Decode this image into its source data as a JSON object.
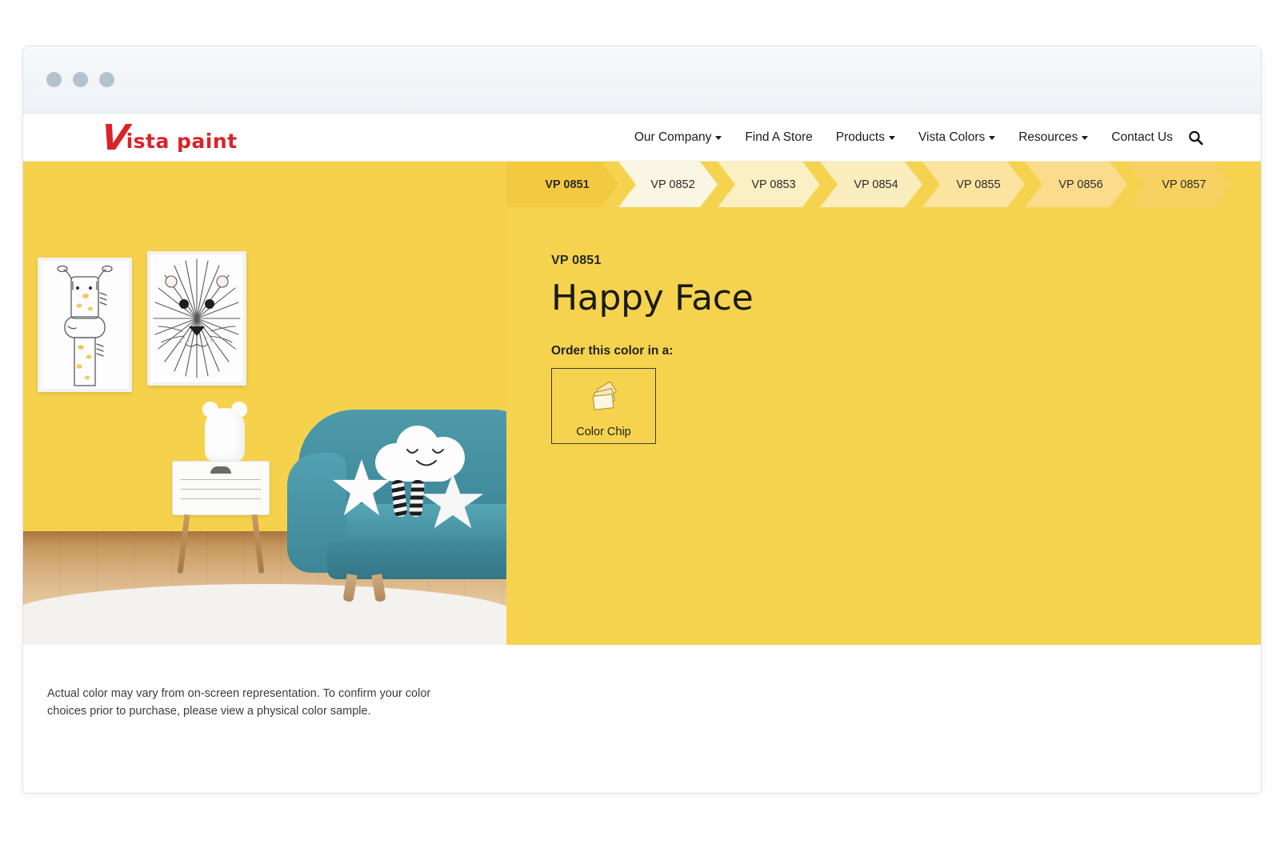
{
  "window": {
    "dots": [
      "close-dot",
      "minimize-dot",
      "maximize-dot"
    ]
  },
  "header": {
    "logo": {
      "initial": "V",
      "rest": "ista paint",
      "full": "Vista Paint",
      "color": "#d8232a"
    },
    "nav": [
      {
        "label": "Our Company",
        "has_caret": true
      },
      {
        "label": "Find A Store",
        "has_caret": false
      },
      {
        "label": "Products",
        "has_caret": true
      },
      {
        "label": "Vista Colors",
        "has_caret": true
      },
      {
        "label": "Resources",
        "has_caret": true
      },
      {
        "label": "Contact Us",
        "has_caret": false
      }
    ],
    "search_icon": "search-icon"
  },
  "chip_tabs": [
    {
      "label": "VP 0851",
      "active": true,
      "fill": "#F3C93F"
    },
    {
      "label": "VP 0852",
      "active": false,
      "fill": "#FAF6E4"
    },
    {
      "label": "VP 0853",
      "active": false,
      "fill": "#FBEFC4"
    },
    {
      "label": "VP 0854",
      "active": false,
      "fill": "#FAEDBE"
    },
    {
      "label": "VP 0855",
      "active": false,
      "fill": "#FBE3A0"
    },
    {
      "label": "VP 0856",
      "active": false,
      "fill": "#FADC8C"
    },
    {
      "label": "VP 0857",
      "active": false,
      "fill": "#F7D263"
    }
  ],
  "color_detail": {
    "code": "VP 0851",
    "name": "Happy Face",
    "swatch_hex": "#F5D34E",
    "order_label": "Order this color in a:",
    "options": [
      {
        "label": "Color Chip",
        "icon": "color-chip-icon"
      }
    ]
  },
  "room_image": {
    "alt": "Yellow nursery room with teal sofa, cloud and star pillows, white nightstand and bear lamp",
    "wall_hex": "#F6D24C",
    "sofa_hex": "#4694A6",
    "art": [
      "giraffe-print",
      "lion-print"
    ]
  },
  "disclaimer": {
    "text": "Actual color may vary from on-screen representation. To confirm your color choices prior to purchase, please view a physical color sample."
  }
}
